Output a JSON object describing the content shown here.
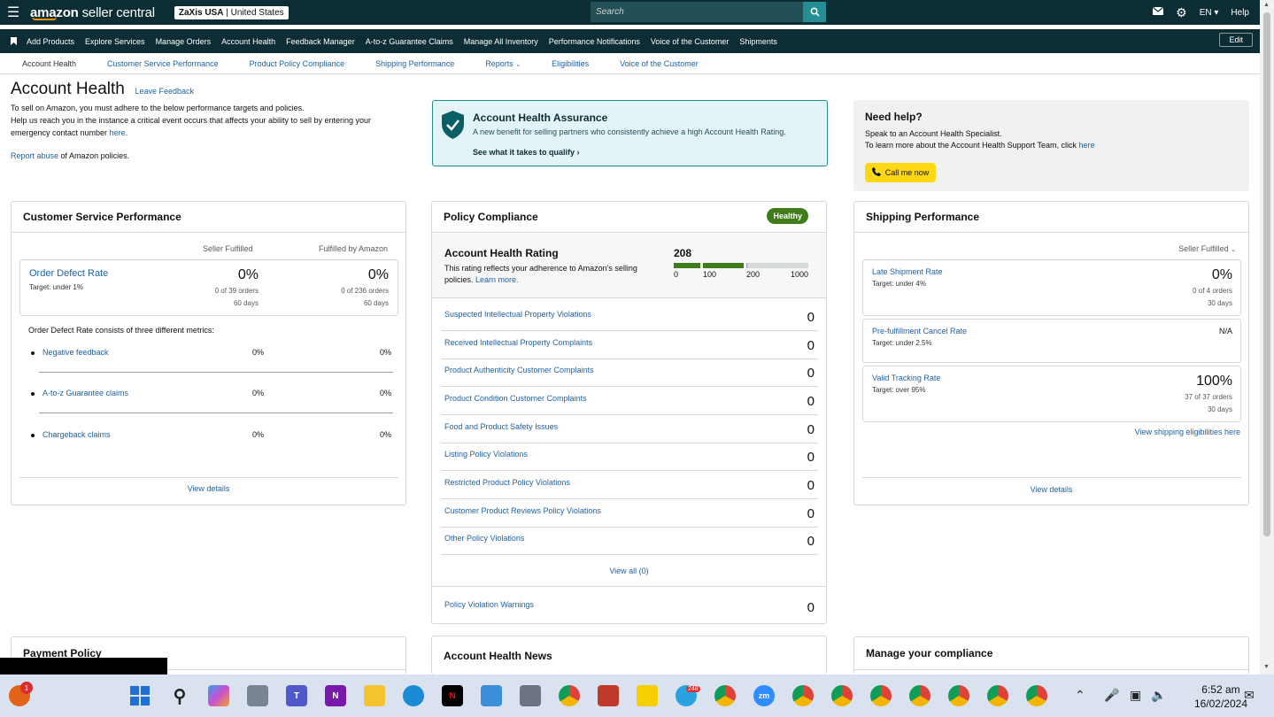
{
  "topbar": {
    "logo_bold": "amazon",
    "logo_rest": " seller central",
    "store_name": "ZaXis USA",
    "store_region": "United States",
    "search_placeholder": "Search",
    "lang": "EN",
    "help": "Help"
  },
  "nav": {
    "items": [
      "Add Products",
      "Explore Services",
      "Manage Orders",
      "Account Health",
      "Feedback Manager",
      "A-to-z Guarantee Claims",
      "Manage All Inventory",
      "Performance Notifications",
      "Voice of the Customer",
      "Shipments"
    ],
    "edit": "Edit"
  },
  "subtabs": [
    "Account Health",
    "Customer Service Performance",
    "Product Policy Compliance",
    "Shipping Performance",
    "Reports",
    "Eligibilities",
    "Voice of the Customer"
  ],
  "header": {
    "title": "Account Health",
    "leave_feedback": "Leave Feedback",
    "line1": "To sell on Amazon, you must adhere to the below performance targets and policies.",
    "line2": "Help us reach you in the instance a critical event occurs that affects your ability to sell by entering your",
    "line3": "emergency contact number",
    "here": "here",
    "report_abuse": "Report abuse",
    "report_rest": " of Amazon policies."
  },
  "aha": {
    "title": "Account Health Assurance",
    "desc": "A new benefit for selling partners who consistently achieve a high Account Health Rating.",
    "link": "See what it takes to qualify"
  },
  "help_box": {
    "title": "Need help?",
    "line1": "Speak to an Account Health Specialist.",
    "line2": "To learn more about the Account Health Support Team, click",
    "here": "here",
    "call": "Call me now"
  },
  "csp": {
    "title": "Customer Service Performance",
    "col1": "Seller Fulfilled",
    "col2": "Fulfilled by Amazon",
    "odr_name": "Order Defect Rate",
    "odr_target": "Target: under 1%",
    "sf_pct": "0%",
    "sf_orders": "0 of 39 orders",
    "sf_days": "60 days",
    "fba_pct": "0%",
    "fba_orders": "0 of 236 orders",
    "fba_days": "60 days",
    "intro": "Order Defect Rate consists of three different metrics:",
    "metrics": [
      {
        "label": "Negative feedback",
        "v1": "0%",
        "v2": "0%"
      },
      {
        "label": "A-to-z Guarantee claims",
        "v1": "0%",
        "v2": "0%"
      },
      {
        "label": "Chargeback claims",
        "v1": "0%",
        "v2": "0%"
      }
    ],
    "view_details": "View details"
  },
  "pc": {
    "title": "Policy Compliance",
    "badge": "Healthy",
    "ahr_title": "Account Health Rating",
    "ahr_desc": "This rating reflects your adherence to Amazon's selling policies.",
    "learn_more": "Learn more.",
    "score": "208",
    "rating_value": 208,
    "ticks": [
      "0",
      "100",
      "200",
      "1000"
    ],
    "rows": [
      {
        "label": "Suspected Intellectual Property Violations",
        "value": "0"
      },
      {
        "label": "Received Intellectual Property Complaints",
        "value": "0"
      },
      {
        "label": "Product Authenticity Customer Complaints",
        "value": "0"
      },
      {
        "label": "Product Condition Customer Complaints",
        "value": "0"
      },
      {
        "label": "Food and Product Safety Issues",
        "value": "0"
      },
      {
        "label": "Listing Policy Violations",
        "value": "0"
      },
      {
        "label": "Restricted Product Policy Violations",
        "value": "0"
      },
      {
        "label": "Customer Product Reviews Policy Violations",
        "value": "0"
      },
      {
        "label": "Other Policy Violations",
        "value": "0"
      }
    ],
    "view_all": "View all (0)",
    "warnings_label": "Policy Violation Warnings",
    "warnings_value": "0",
    "colors": {
      "green": "#3f7d1c",
      "gray": "#d5d9d9"
    }
  },
  "sp": {
    "title": "Shipping Performance",
    "filter": "Seller Fulfilled",
    "late_name": "Late Shipment Rate",
    "late_target": "Target: under 4%",
    "late_pct": "0%",
    "late_orders": "0 of 4 orders",
    "late_days": "30 days",
    "cancel_name": "Pre-fulfillment Cancel Rate",
    "cancel_target": "Target: under 2.5%",
    "cancel_pct": "N/A",
    "vtr_name": "Valid Tracking Rate",
    "vtr_target": "Target: over 95%",
    "vtr_pct": "100%",
    "vtr_orders": "37 of 37 orders",
    "vtr_days": "30 days",
    "elig_link": "View shipping eligibilities here",
    "view_details": "View details"
  },
  "bottom": {
    "payment": "Payment Policy",
    "news": "Account Health News",
    "compliance": "Manage your compliance"
  },
  "taskbar": {
    "time": "6:52 am",
    "date": "16/02/2024",
    "notif_count": "1",
    "telegram_count": "248"
  }
}
